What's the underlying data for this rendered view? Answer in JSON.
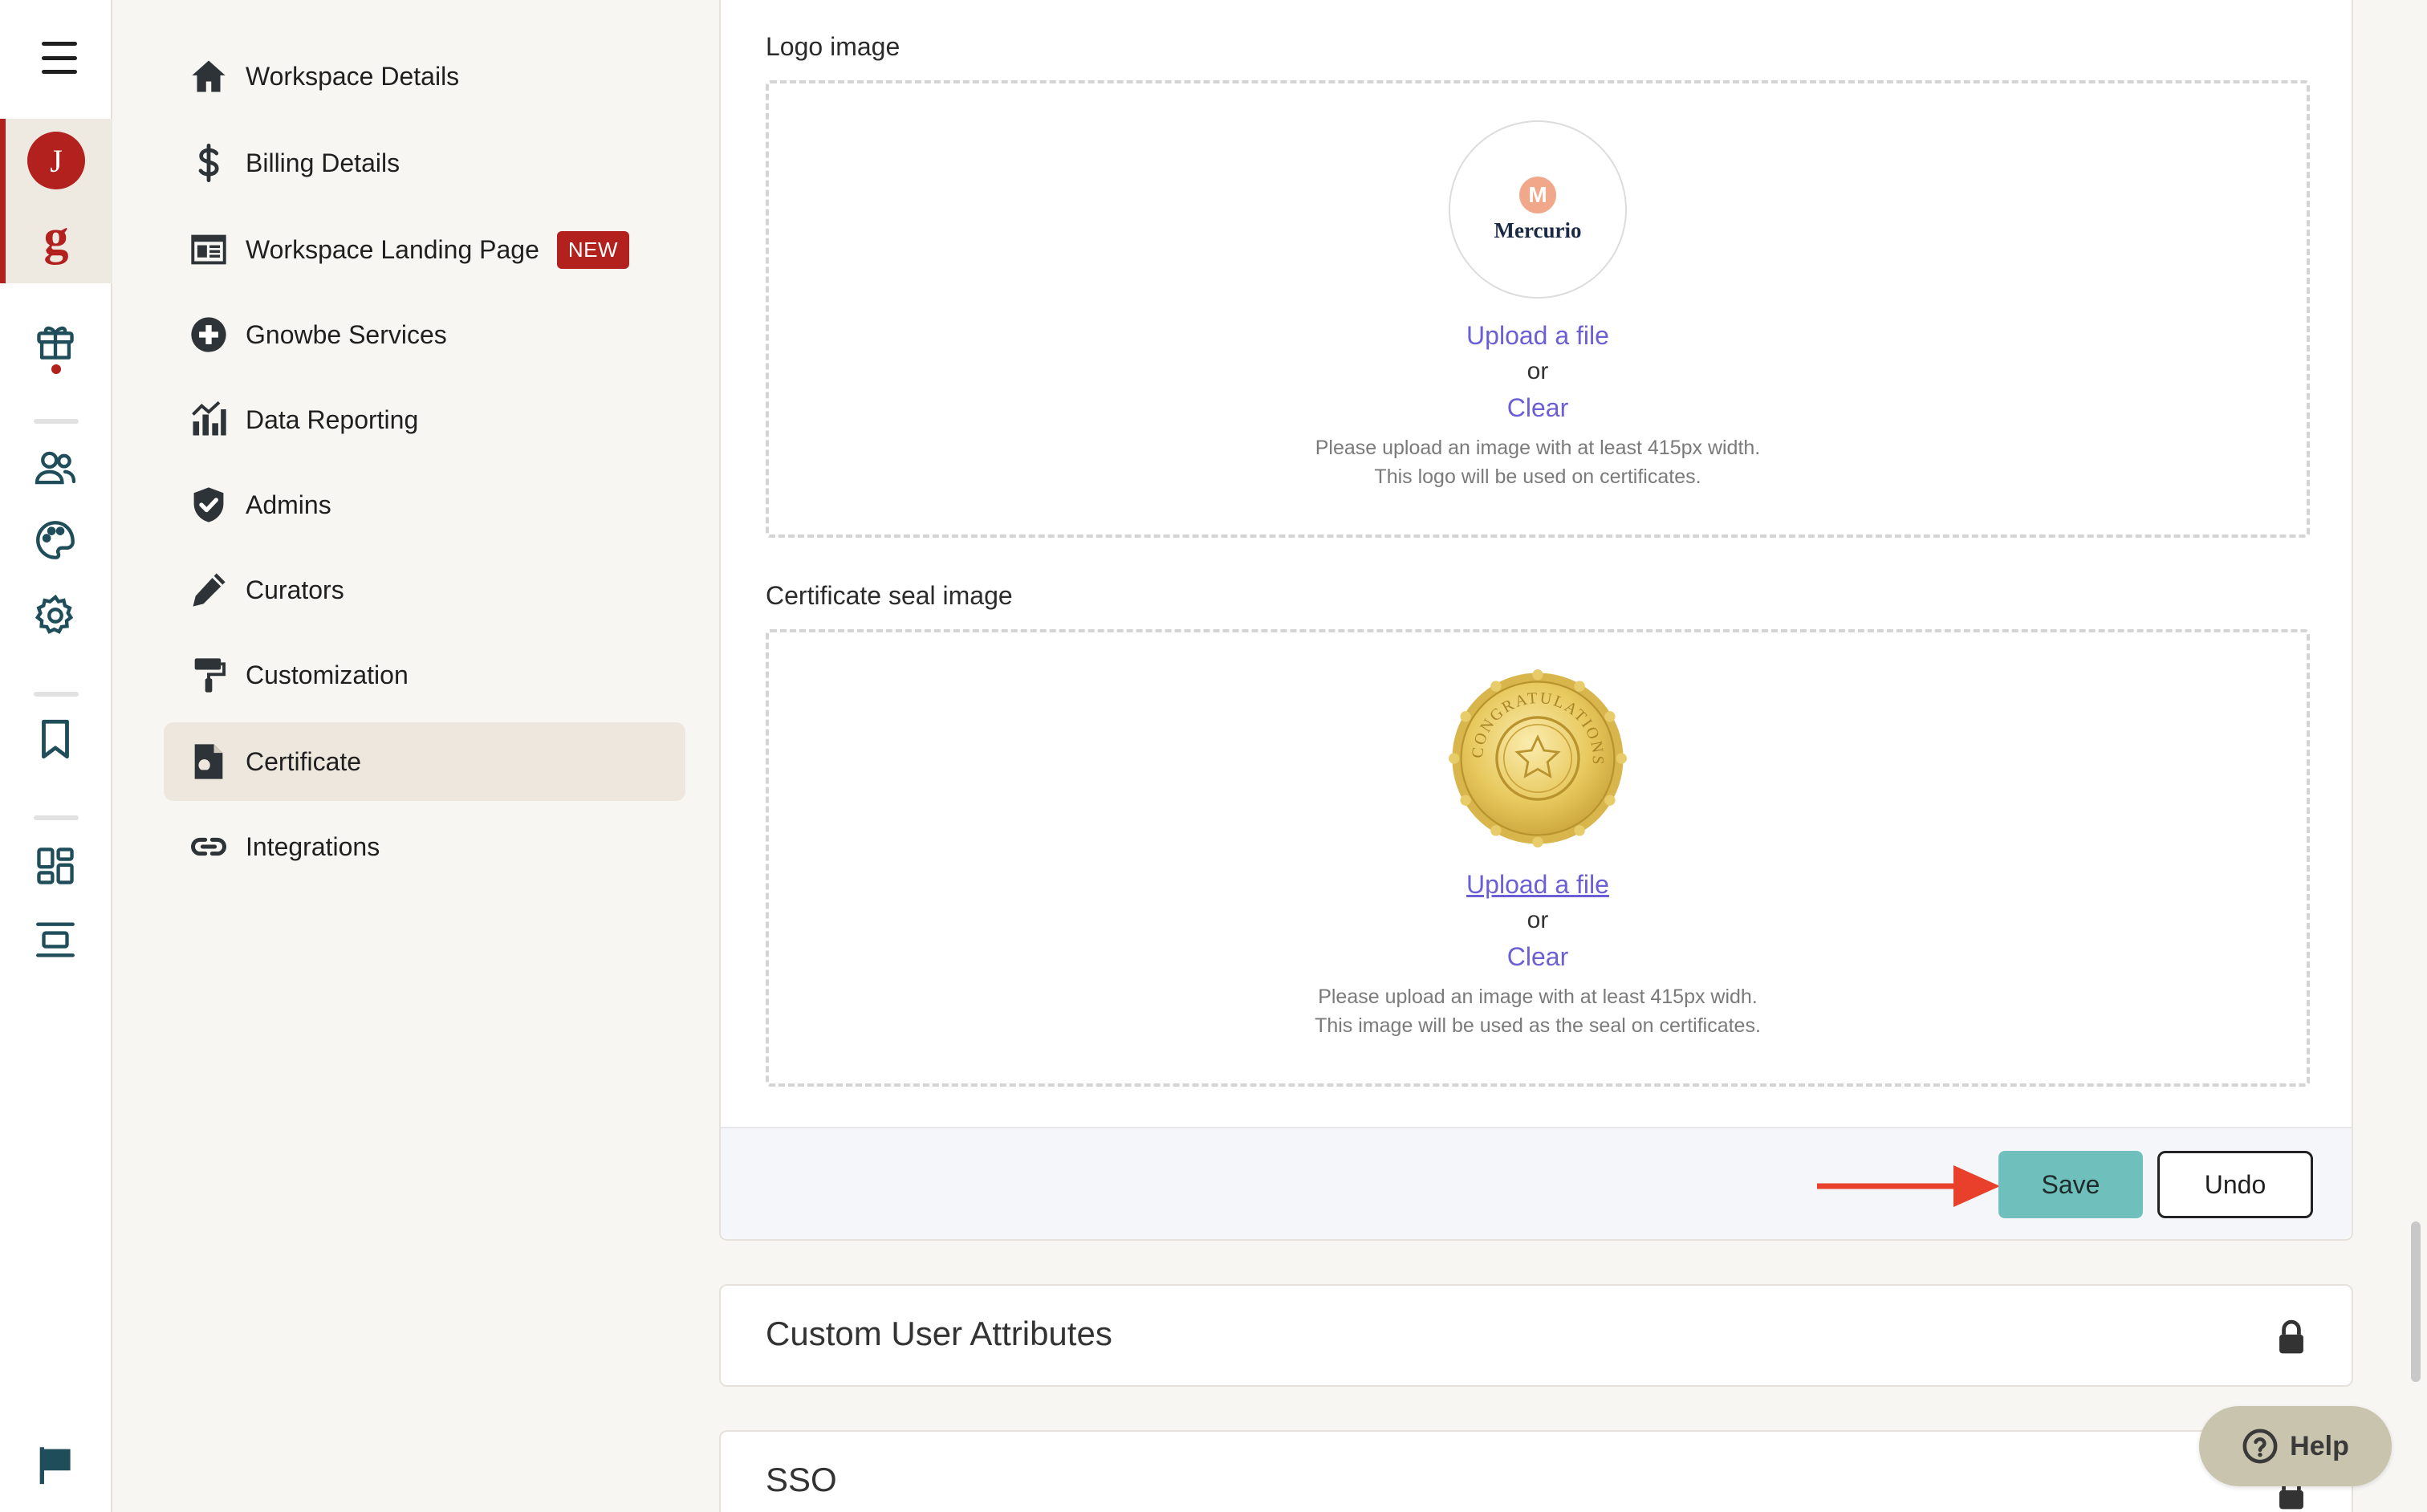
{
  "rail": {
    "avatar_letter": "J",
    "brand_letter": "g"
  },
  "nav": {
    "items": [
      {
        "label": "Workspace Details",
        "icon": "home-icon"
      },
      {
        "label": "Billing Details",
        "icon": "dollar-icon"
      },
      {
        "label": "Workspace Landing Page",
        "icon": "browser-window-icon",
        "badge": "NEW"
      },
      {
        "label": "Gnowbe Services",
        "icon": "plus-circle-icon"
      },
      {
        "label": "Data Reporting",
        "icon": "chart-icon"
      },
      {
        "label": "Admins",
        "icon": "shield-check-icon"
      },
      {
        "label": "Curators",
        "icon": "pencil-icon"
      },
      {
        "label": "Customization",
        "icon": "paint-roller-icon"
      },
      {
        "label": "Certificate",
        "icon": "certificate-icon",
        "active": true
      },
      {
        "label": "Integrations",
        "icon": "link-icon"
      }
    ]
  },
  "logo_section": {
    "title": "Logo image",
    "logo_brand": "Mercurio",
    "logo_letter": "M",
    "upload_label": "Upload a file",
    "or_label": "or",
    "clear_label": "Clear",
    "hint_line1": "Please upload an image with at least 415px width.",
    "hint_line2": "This logo will be used on certificates."
  },
  "seal_section": {
    "title": "Certificate seal image",
    "seal_text": "CONGRATULATIONS",
    "upload_label": "Upload a file",
    "or_label": "or",
    "clear_label": "Clear",
    "hint_line1": "Please upload an image with at least 415px widh.",
    "hint_line2": "This image will be used as the seal on certificates."
  },
  "actions": {
    "save_label": "Save",
    "undo_label": "Undo"
  },
  "collapsed_sections": {
    "custom_attributes": "Custom User Attributes",
    "sso": "SSO"
  },
  "help": {
    "label": "Help"
  },
  "colors": {
    "brand_red": "#b3211e",
    "save_teal": "#6fbfbd",
    "link_purple": "#6b5fd6",
    "arrow_red": "#e8402a"
  }
}
